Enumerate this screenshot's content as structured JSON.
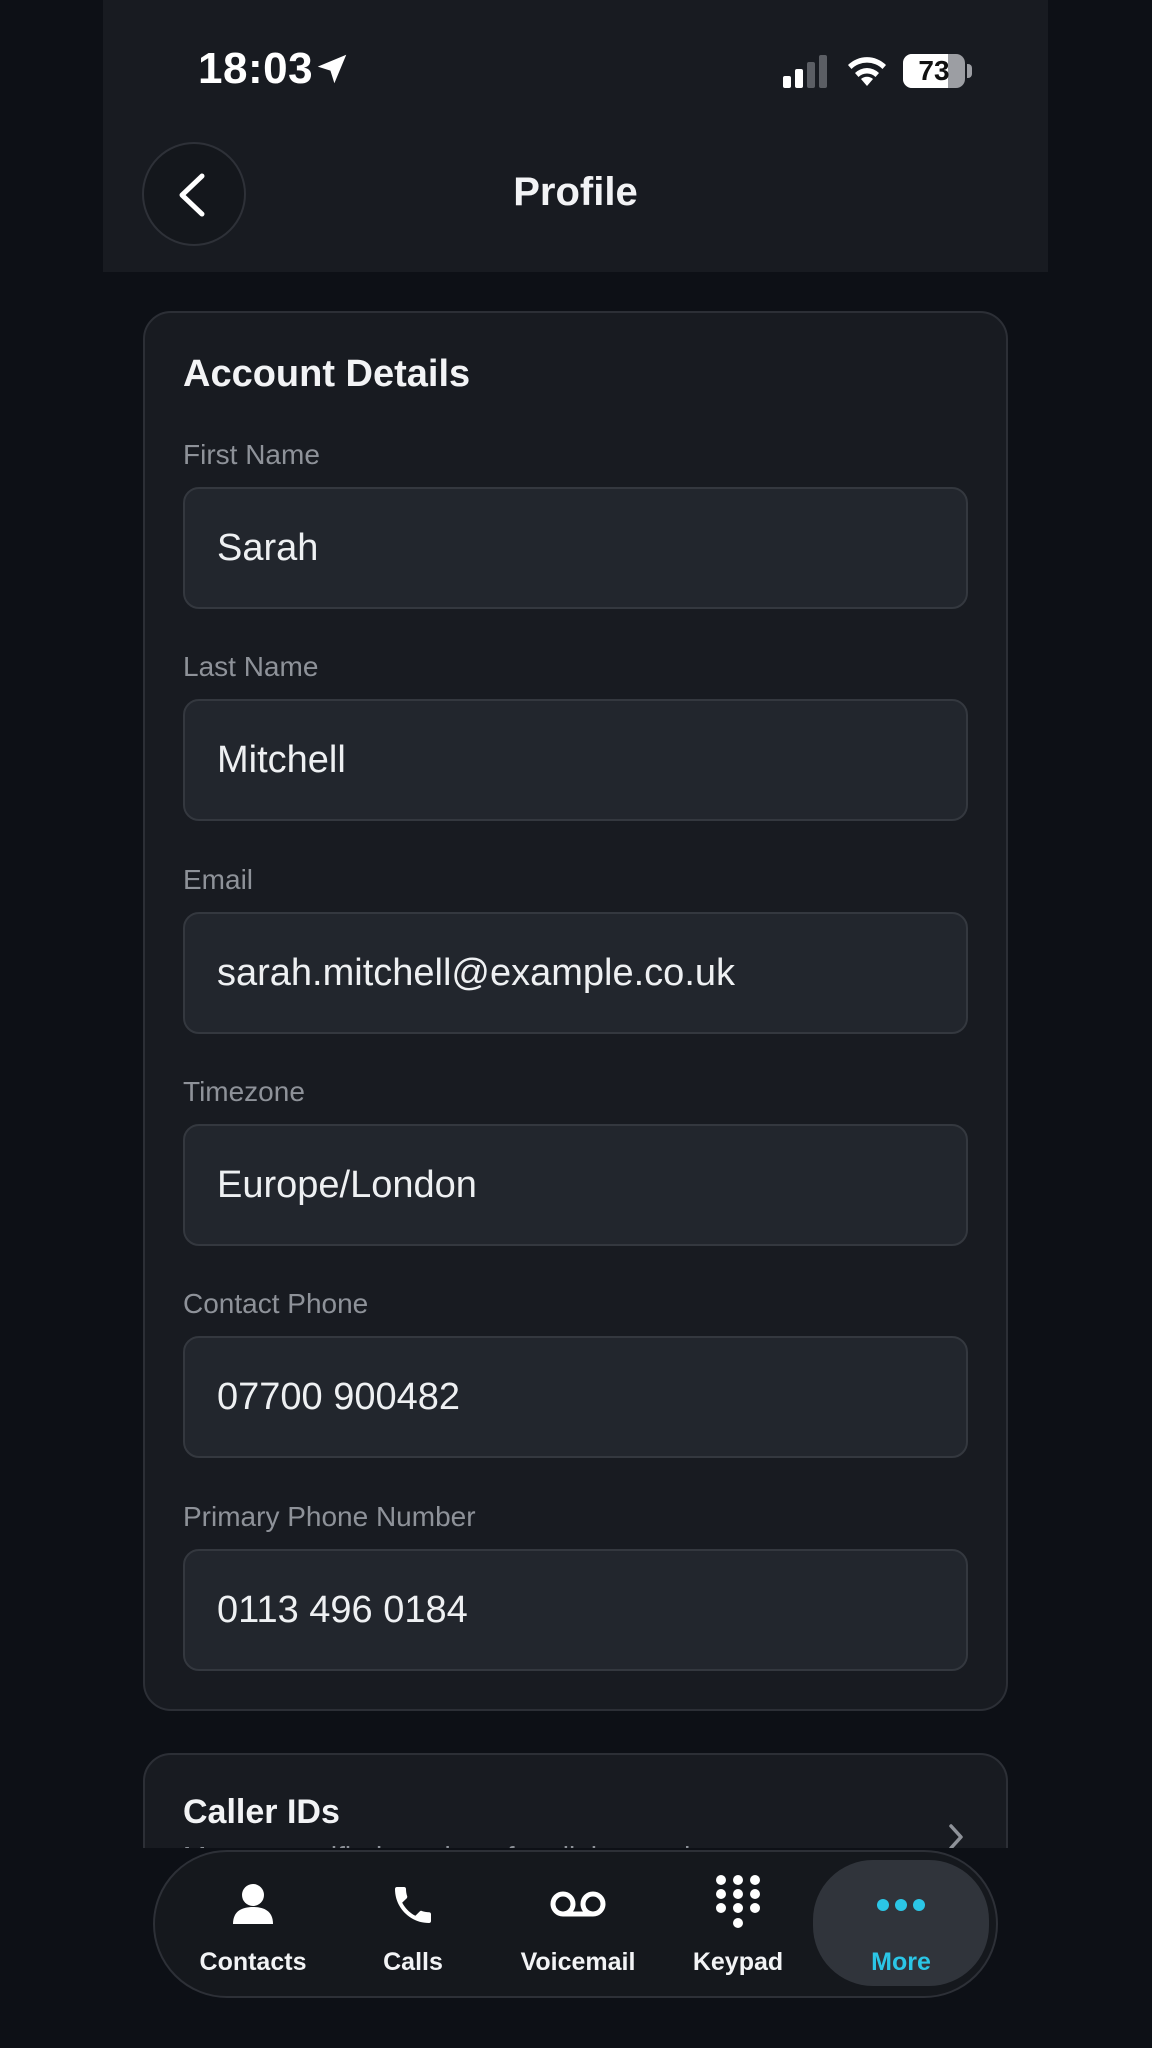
{
  "status_bar": {
    "time": "18:03",
    "battery": "73",
    "battery_level": 0.73
  },
  "header": {
    "title": "Profile"
  },
  "account_details": {
    "title": "Account Details",
    "fields": [
      {
        "label": "First Name",
        "value": "Sarah"
      },
      {
        "label": "Last Name",
        "value": "Mitchell"
      },
      {
        "label": "Email",
        "value": "sarah.mitchell@example.co.uk"
      },
      {
        "label": "Timezone",
        "value": "Europe/London"
      },
      {
        "label": "Contact Phone",
        "value": "07700 900482"
      },
      {
        "label": "Primary Phone Number",
        "value": "0113 496 0184"
      }
    ]
  },
  "caller_ids": {
    "title": "Caller IDs",
    "subtitle": "Manage verified numbers for all the numbers"
  },
  "tab_bar": {
    "tabs": [
      {
        "label": "Contacts",
        "icon": "person-icon"
      },
      {
        "label": "Calls",
        "icon": "phone-icon"
      },
      {
        "label": "Voicemail",
        "icon": "voicemail-icon"
      },
      {
        "label": "Keypad",
        "icon": "keypad-icon"
      },
      {
        "label": "More",
        "icon": "more-icon"
      }
    ],
    "active": "More",
    "accent_color": "#2bc6e6"
  }
}
